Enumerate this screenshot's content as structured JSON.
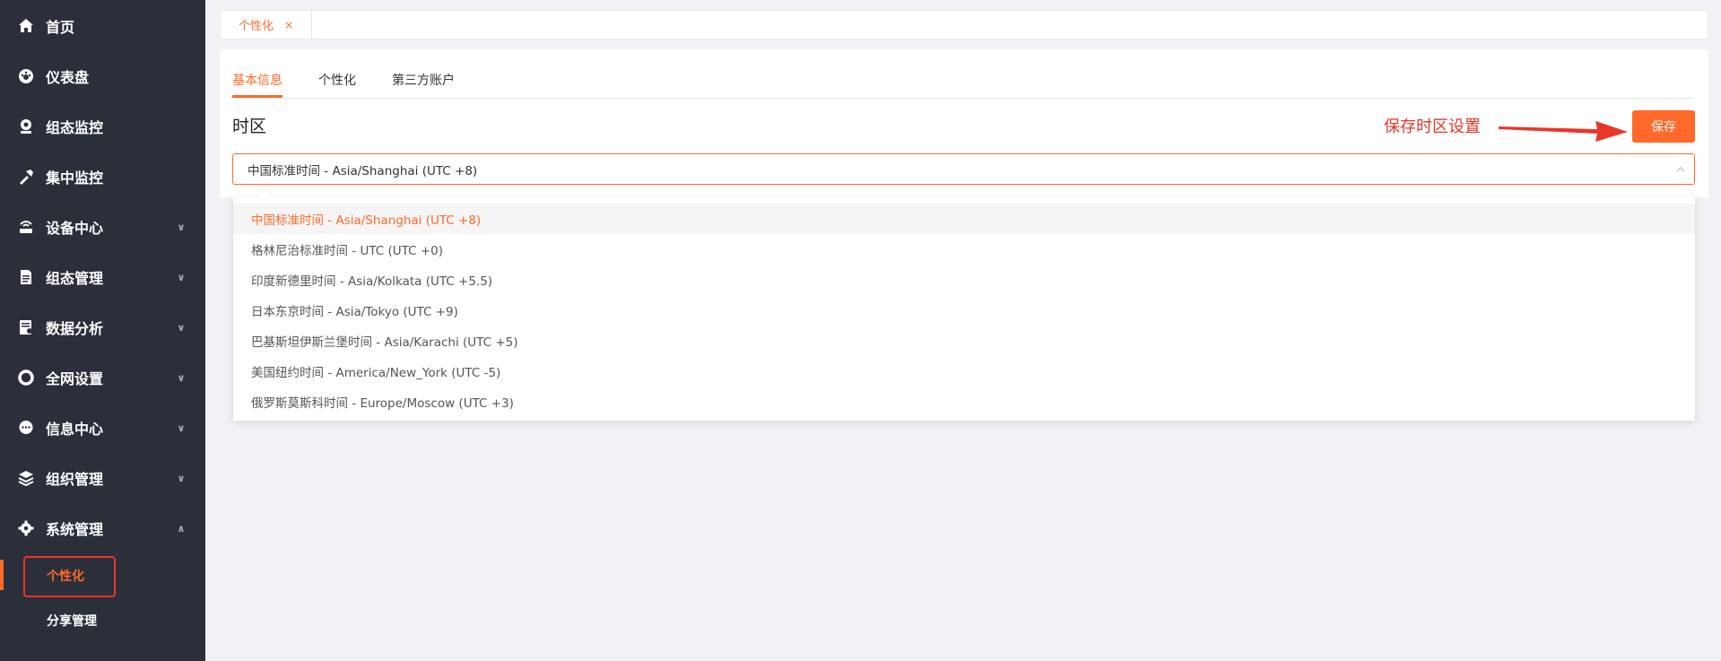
{
  "sidebar": {
    "items": [
      {
        "label": "首页",
        "icon": "home-icon",
        "has_children": false
      },
      {
        "label": "仪表盘",
        "icon": "dashboard-icon",
        "has_children": false
      },
      {
        "label": "组态监控",
        "icon": "webcam-icon",
        "has_children": false
      },
      {
        "label": "集中监控",
        "icon": "tools-icon",
        "has_children": false
      },
      {
        "label": "设备中心",
        "icon": "router-icon",
        "has_children": true
      },
      {
        "label": "组态管理",
        "icon": "document-icon",
        "has_children": true
      },
      {
        "label": "数据分析",
        "icon": "report-icon",
        "has_children": true
      },
      {
        "label": "全网设置",
        "icon": "ring-icon",
        "has_children": true
      },
      {
        "label": "信息中心",
        "icon": "chat-bubble-icon",
        "has_children": true
      },
      {
        "label": "组织管理",
        "icon": "layers-icon",
        "has_children": true
      },
      {
        "label": "系统管理",
        "icon": "gear-icon",
        "has_children": true,
        "expanded": true
      }
    ],
    "sub_items": [
      {
        "label": "个性化",
        "active": true
      },
      {
        "label": "分享管理",
        "active": false
      }
    ]
  },
  "page_tabs": [
    {
      "label": "个性化",
      "close": "×"
    }
  ],
  "settings": {
    "tabs": [
      {
        "label": "基本信息",
        "active": true
      },
      {
        "label": "个性化",
        "active": false
      },
      {
        "label": "第三方账户",
        "active": false
      }
    ],
    "section_title": "时区",
    "save_label": "保存",
    "annotation": "保存时区设置",
    "timezone_value": "中国标准时间 - Asia/Shanghai (UTC +8)",
    "options": [
      "中国标准时间 - Asia/Shanghai (UTC +8)",
      "格林尼治标准时间 - UTC (UTC +0)",
      "印度新德里时间 - Asia/Kolkata (UTC +5.5)",
      "日本东京时间 - Asia/Tokyo (UTC +9)",
      "巴基斯坦伊斯兰堡时间 - Asia/Karachi (UTC +5)",
      "美国纽约时间 - America/New_York (UTC -5)",
      "俄罗斯莫斯科时间 - Europe/Moscow (UTC +3)"
    ],
    "selected_index": 0
  },
  "colors": {
    "accent": "#ff6a2b",
    "sidebar_bg": "#2b2f3a",
    "annotation": "#e8362a",
    "page_bg": "#f0f2f5"
  }
}
